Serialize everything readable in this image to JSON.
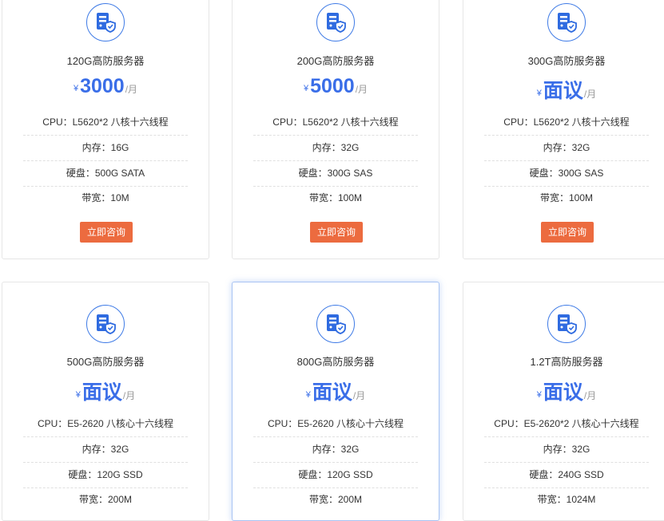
{
  "cards": [
    {
      "name": "120G高防服务器",
      "currency": "¥",
      "price": "3000",
      "unit": "/月",
      "specs": [
        "CPU：L5620*2 八核十六线程",
        "内存：16G",
        "硬盘：500G SATA",
        "带宽：10M"
      ],
      "button": "立即咨询"
    },
    {
      "name": "200G高防服务器",
      "currency": "¥",
      "price": "5000",
      "unit": "/月",
      "specs": [
        "CPU：L5620*2 八核十六线程",
        "内存：32G",
        "硬盘：300G SAS",
        "带宽：100M"
      ],
      "button": "立即咨询"
    },
    {
      "name": "300G高防服务器",
      "currency": "¥",
      "price": "面议",
      "unit": "/月",
      "specs": [
        "CPU：L5620*2 八核十六线程",
        "内存：32G",
        "硬盘：300G SAS",
        "带宽：100M"
      ],
      "button": "立即咨询"
    },
    {
      "name": "500G高防服务器",
      "currency": "¥",
      "price": "面议",
      "unit": "/月",
      "specs": [
        "CPU：E5-2620 八核心十六线程",
        "内存：32G",
        "硬盘：120G SSD",
        "带宽：200M"
      ]
    },
    {
      "name": "800G高防服务器",
      "currency": "¥",
      "price": "面议",
      "unit": "/月",
      "specs": [
        "CPU：E5-2620 八核心十六线程",
        "内存：32G",
        "硬盘：120G SSD",
        "带宽：200M"
      ]
    },
    {
      "name": "1.2T高防服务器",
      "currency": "¥",
      "price": "面议",
      "unit": "/月",
      "specs": [
        "CPU：E5-2620*2 八核心十六线程",
        "内存：32G",
        "硬盘：240G SSD",
        "带宽：1024M"
      ]
    }
  ],
  "icon": "server-shield-icon",
  "colors": {
    "accent": "#3a6ee8",
    "button": "#ec6b3f",
    "border": "#e6e6e6",
    "highlight_border": "#a9c4f3"
  }
}
